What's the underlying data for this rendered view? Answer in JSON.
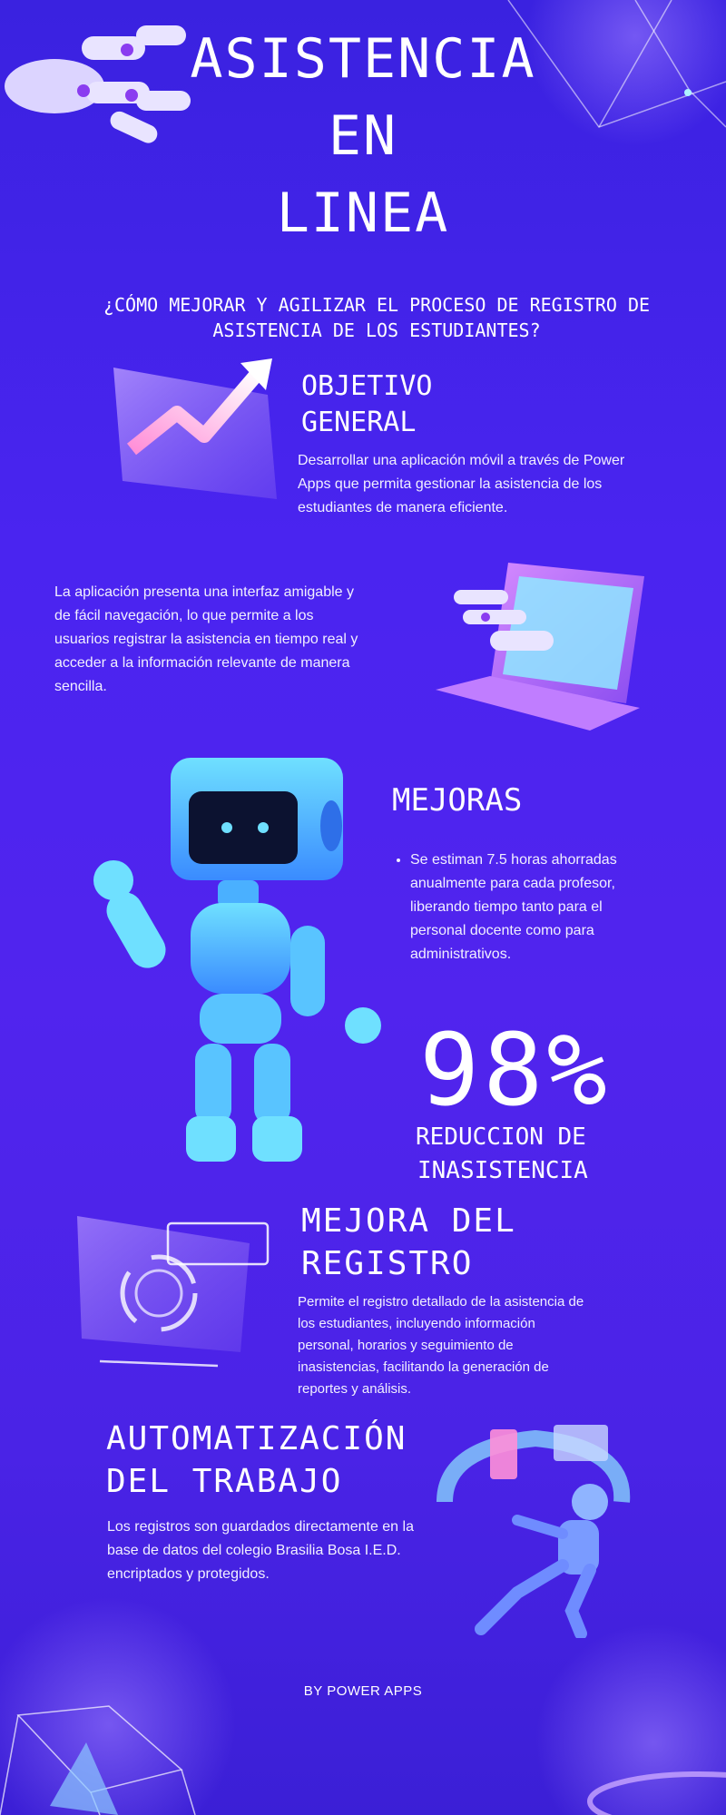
{
  "header": {
    "title_lines": [
      "ASISTENCIA",
      "EN",
      "LINEA"
    ],
    "question": "¿CÓMO MEJORAR Y AGILIZAR EL PROCESO DE REGISTRO DE ASISTENCIA DE LOS ESTUDIANTES?"
  },
  "objetivo": {
    "heading_lines": [
      "OBJETIVO",
      "GENERAL"
    ],
    "text": "Desarrollar una aplicación móvil a través de Power Apps que permita gestionar la asistencia de los estudiantes de manera eficiente."
  },
  "interfaz": {
    "text": "La aplicación presenta una interfaz amigable y de fácil navegación, lo que permite a los usuarios registrar la asistencia en tiempo real y acceder a la información relevante de manera sencilla."
  },
  "mejoras": {
    "heading": "MEJORAS",
    "bullet": "Se estiman 7.5 horas ahorradas anualmente para cada profesor, liberando tiempo tanto para el personal docente como para administrativos.",
    "stat_value": "98%",
    "stat_label_lines": [
      "REDUCCION DE",
      "INASISTENCIA"
    ]
  },
  "registro": {
    "heading_lines": [
      "MEJORA DEL",
      "REGISTRO"
    ],
    "text": "Permite el registro detallado de la asistencia de los estudiantes, incluyendo información personal, horarios y seguimiento de inasistencias, facilitando la generación de reportes y análisis."
  },
  "automatizacion": {
    "heading_lines": [
      "AUTOMATIZACIÓN",
      "DEL TRABAJO"
    ],
    "text": "Los registros son guardados directamente en la base de datos del colegio Brasilia Bosa I.E.D. encriptados y protegidos."
  },
  "footer": {
    "text": "BY POWER APPS"
  },
  "colors": {
    "bg_top": "#3a22e0",
    "bg_mid": "#5124ee",
    "accent_cyan": "#5fd0ff",
    "accent_lilac": "#c9a6ff"
  },
  "icons": [
    "robot-hand-icon",
    "growth-arrow-icon",
    "laptop-hand-icon",
    "robot-icon",
    "hologram-screen-icon",
    "robot-with-screens-icon",
    "crystal-cube-icon"
  ]
}
